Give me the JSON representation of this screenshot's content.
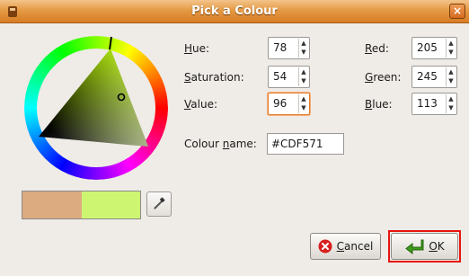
{
  "window": {
    "title": "Pick a Colour",
    "close_glyph": "×"
  },
  "hsv": {
    "hue": {
      "label": "Hue:",
      "mnemonic": "H",
      "rest": "ue:",
      "value": "78"
    },
    "saturation": {
      "label": "Saturation:",
      "mnemonic": "S",
      "rest": "aturation:",
      "value": "54"
    },
    "value": {
      "label": "Value:",
      "mnemonic": "V",
      "rest": "alue:",
      "value": "96"
    }
  },
  "rgb": {
    "red": {
      "label": "Red:",
      "mnemonic": "R",
      "rest": "ed:",
      "value": "205"
    },
    "green": {
      "label": "Green:",
      "mnemonic": "G",
      "rest": "reen:",
      "value": "245"
    },
    "blue": {
      "label": "Blue:",
      "mnemonic": "B",
      "rest": "lue:",
      "value": "113"
    }
  },
  "colour_name": {
    "label_pre": "Colour ",
    "mnemonic": "n",
    "label_post": "ame:",
    "value": "#CDF571"
  },
  "swatch": {
    "previous_color": "#dcab80",
    "current_color": "#cdf571"
  },
  "buttons": {
    "cancel": {
      "mnemonic": "C",
      "rest": "ancel"
    },
    "ok": {
      "mnemonic": "O",
      "rest": "K"
    }
  },
  "colors": {
    "accent": "#e59a45",
    "highlight": "#e8140e"
  },
  "icons": [
    "window-icon",
    "close-icon",
    "eyedropper-icon",
    "cancel-icon",
    "ok-icon",
    "spin-up-icon",
    "spin-down-icon"
  ]
}
